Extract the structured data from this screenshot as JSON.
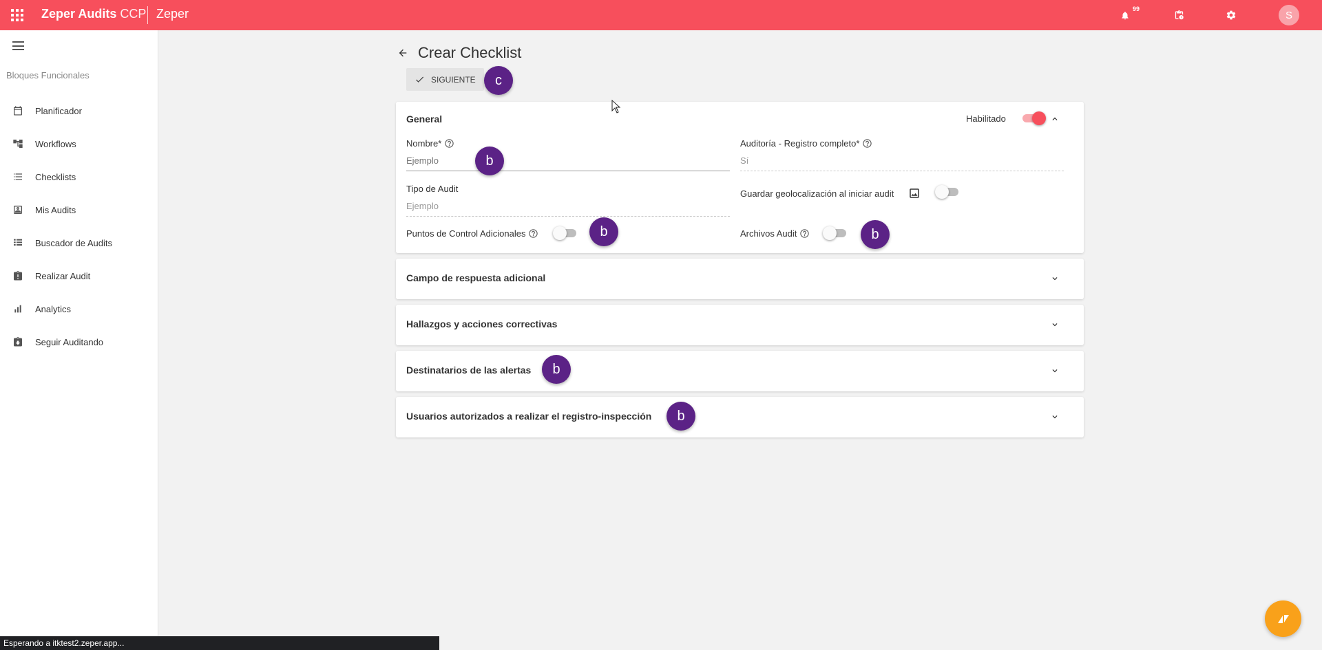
{
  "topbar": {
    "brand_bold": "Zeper Audits",
    "brand_light": "CCP",
    "company": "Zeper",
    "notification_count": "99",
    "avatar_initial": "S",
    "color": "#f74f5c"
  },
  "sidebar": {
    "section_label": "Bloques Funcionales",
    "items": [
      {
        "label": "Planificador",
        "icon": "calendar-icon"
      },
      {
        "label": "Workflows",
        "icon": "workflow-icon"
      },
      {
        "label": "Checklists",
        "icon": "checklist-icon"
      },
      {
        "label": "Mis Audits",
        "icon": "contact-card-icon"
      },
      {
        "label": "Buscador de Audits",
        "icon": "list-icon"
      },
      {
        "label": "Realizar Audit",
        "icon": "clipboard-alert-icon"
      },
      {
        "label": "Analytics",
        "icon": "bar-chart-icon"
      },
      {
        "label": "Seguir Auditando",
        "icon": "clipboard-down-icon"
      }
    ]
  },
  "main": {
    "title": "Crear Checklist",
    "next_label": "SIGUIENTE",
    "general": {
      "title": "General",
      "enabled_label": "Habilitado",
      "enabled": true,
      "name_label": "Nombre*",
      "name_value": "Ejemplo",
      "complete_label": "Auditoría - Registro completo*",
      "complete_value": "Sí",
      "type_label": "Tipo de Audit",
      "type_value": "Ejemplo",
      "geo_label": "Guardar geolocalización al iniciar audit",
      "geo_enabled": false,
      "extra_points_label": "Puntos de Control Adicionales",
      "extra_points_enabled": false,
      "files_label": "Archivos Audit",
      "files_enabled": false
    },
    "sections": [
      {
        "title": "Campo de respuesta adicional"
      },
      {
        "title": "Hallazgos y acciones correctivas"
      },
      {
        "title": "Destinatarios de las alertas"
      },
      {
        "title": "Usuarios autorizados a realizar el registro-inspección"
      }
    ]
  },
  "markers": {
    "b": "b",
    "c": "c",
    "color": "#5b2286"
  },
  "status_bar": "Esperando a itktest2.zeper.app..."
}
